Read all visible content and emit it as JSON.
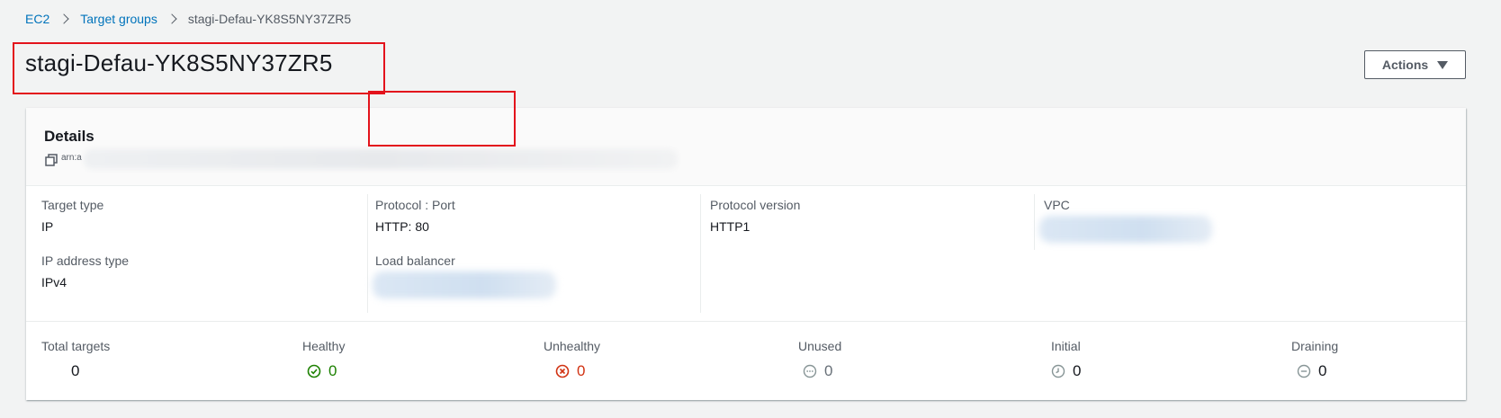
{
  "breadcrumb": {
    "items": [
      {
        "label": "EC2"
      },
      {
        "label": "Target groups"
      }
    ],
    "current": "stagi-Defau-YK8S5NY37ZR5"
  },
  "page": {
    "title": "stagi-Defau-YK8S5NY37ZR5",
    "actions_label": "Actions"
  },
  "details": {
    "title": "Details",
    "arn_prefix": "arn:a",
    "fields": {
      "target_type": {
        "label": "Target type",
        "value": "IP"
      },
      "protocol_port": {
        "label": "Protocol : Port",
        "value": "HTTP: 80"
      },
      "protocol_version": {
        "label": "Protocol version",
        "value": "HTTP1"
      },
      "vpc": {
        "label": "VPC"
      },
      "ip_address_type": {
        "label": "IP address type",
        "value": "IPv4"
      },
      "load_balancer": {
        "label": "Load balancer"
      }
    }
  },
  "counts": {
    "total": {
      "label": "Total targets",
      "value": "0"
    },
    "healthy": {
      "label": "Healthy",
      "value": "0",
      "color": "#1d8102"
    },
    "unhealthy": {
      "label": "Unhealthy",
      "value": "0",
      "color": "#d13212"
    },
    "unused": {
      "label": "Unused",
      "value": "0",
      "color": "#687078"
    },
    "initial": {
      "label": "Initial",
      "value": "0",
      "color": "#687078"
    },
    "draining": {
      "label": "Draining",
      "value": "0",
      "color": "#687078"
    }
  },
  "icons": {
    "healthy": "check-circle-icon",
    "unhealthy": "x-circle-icon",
    "unused": "ellipsis-circle-icon",
    "initial": "clock-icon",
    "draining": "minus-circle-icon",
    "copy": "copy-icon"
  }
}
